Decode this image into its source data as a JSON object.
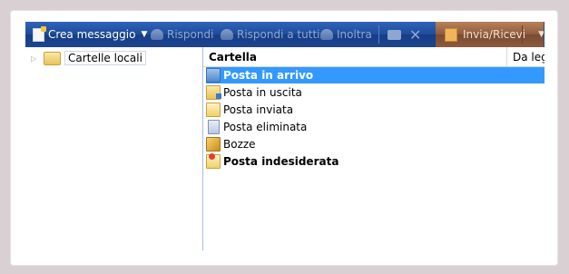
{
  "toolbar": {
    "new_message": "Crea messaggio",
    "reply": "Rispondi",
    "reply_all": "Rispondi a tutti",
    "forward": "Inoltra",
    "send_receive": "Invia/Ricevi"
  },
  "tree": {
    "root_label": "Cartelle locali"
  },
  "list": {
    "columns": [
      "Cartella",
      "Da leggere"
    ],
    "rows": [
      {
        "label": "Posta in arrivo",
        "bold": true,
        "selected": true,
        "icon": "inbox-icon"
      },
      {
        "label": "Posta in uscita",
        "bold": false,
        "selected": false,
        "icon": "outbox-icon"
      },
      {
        "label": "Posta inviata",
        "bold": false,
        "selected": false,
        "icon": "sent-icon"
      },
      {
        "label": "Posta eliminata",
        "bold": false,
        "selected": false,
        "icon": "trash-icon"
      },
      {
        "label": "Bozze",
        "bold": false,
        "selected": false,
        "icon": "drafts-icon"
      },
      {
        "label": "Posta indesiderata",
        "bold": true,
        "selected": false,
        "icon": "junk-icon"
      }
    ]
  },
  "colors": {
    "toolbar": "#1f4b9a",
    "send_receive": "#8e5c3f",
    "selection": "#3399ff",
    "background": "#d9d0d4"
  }
}
